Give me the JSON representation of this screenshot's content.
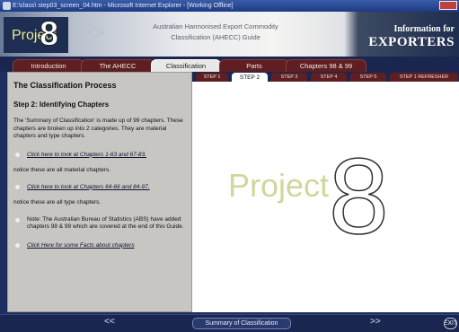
{
  "window": {
    "title": "E:\\class\\ step03_screen_04.htm - Microsoft Internet Explorer - [Working Offline]"
  },
  "banner": {
    "logo_word": "Project",
    "logo_number": "8",
    "chevrons": ">>",
    "subtitle_line1": "Australian Harmonised Export Commodity",
    "subtitle_line2": "Classification (AHECC) Guide",
    "right_line1": "Information for",
    "right_line2": "EXPORTERS"
  },
  "tabs": [
    {
      "label": "Introduction"
    },
    {
      "label": "The AHECC"
    },
    {
      "label": "Classification",
      "active": true
    },
    {
      "label": "Parts"
    },
    {
      "label": "Chapters 98 & 99"
    }
  ],
  "steps": [
    {
      "label": "STEP 1"
    },
    {
      "label": "STEP 2",
      "active": true
    },
    {
      "label": "STEP 3"
    },
    {
      "label": "STEP 4"
    },
    {
      "label": "STEP 5"
    },
    {
      "label": "STEP 1 REFRESHER"
    }
  ],
  "left": {
    "heading": "The Classification Process",
    "step_title": "Step 2: Identifying Chapters",
    "intro": "The 'Summary of Classification' is made up of 99 chapters. These chapters are broken up into 2 categories. They are material chapters and type chapters.",
    "link1": "Click here to look at Chapters 1-63 and 67-83.",
    "note1": "notice these are all material chapters.",
    "link2": "Click here to look at Chapters 64-66 and 84-97.",
    "note2": "notice these are all type chapters.",
    "abs_note": "Note: The Australian Bureau of Statistics (ABS) have added chapters 98 & 99 which are covered at the end of this Guide.",
    "link3": "Click Here for some Facts about chapters"
  },
  "content": {
    "wm_word": "Project",
    "wm_number": "8"
  },
  "bottom": {
    "prev": "<<",
    "summary": "Summary of Classification",
    "next": ">>",
    "exit": "EXIT"
  },
  "colors": {
    "tab": "#5f1f22",
    "tab_active": "#e8e8e6",
    "nav_bg": "#1a2650",
    "panel": "#c7c6c3"
  }
}
